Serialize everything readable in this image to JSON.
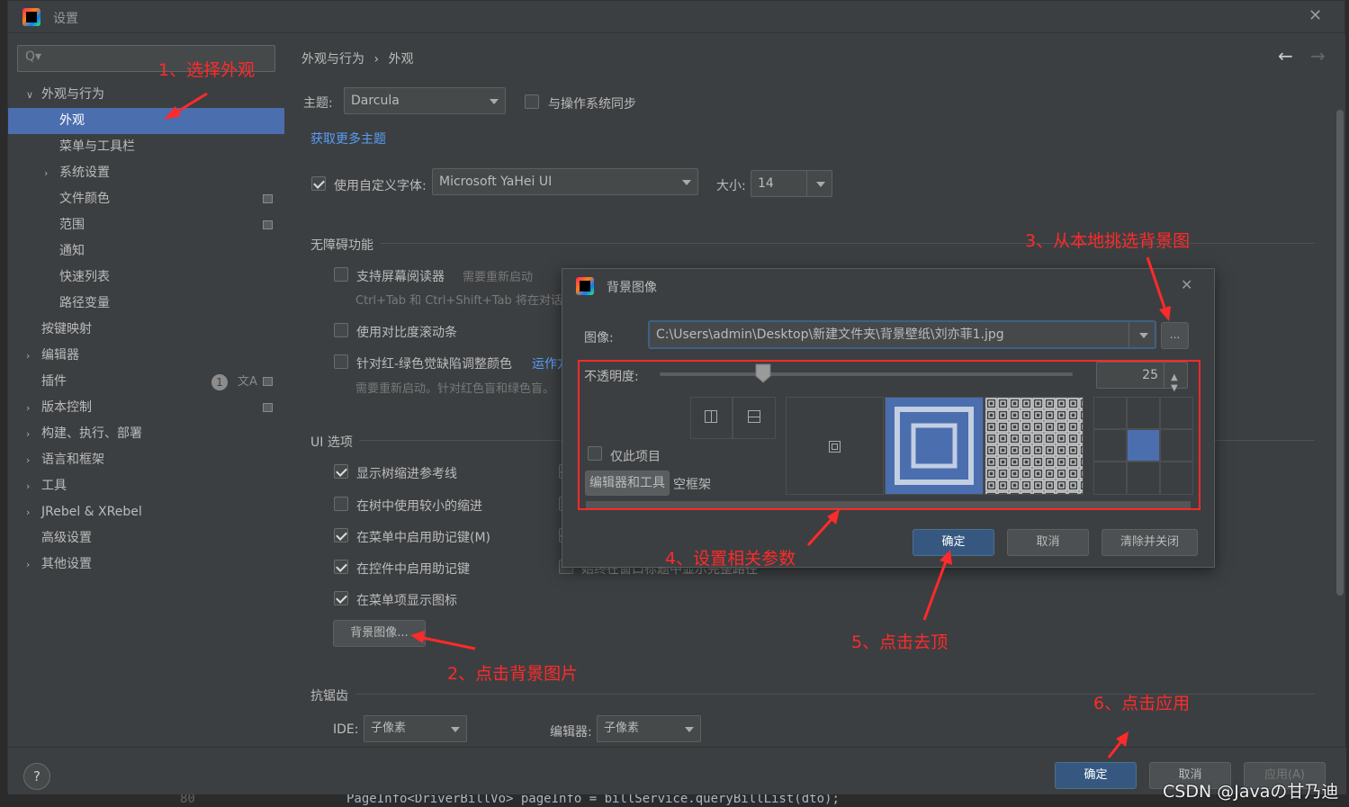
{
  "titlebar": {
    "title": "设置"
  },
  "search": {
    "placeholder": "Q▾"
  },
  "sidebar": {
    "items": [
      {
        "label": "外观与行为"
      },
      {
        "label": "外观"
      },
      {
        "label": "菜单与工具栏"
      },
      {
        "label": "系统设置"
      },
      {
        "label": "文件颜色"
      },
      {
        "label": "范围"
      },
      {
        "label": "通知"
      },
      {
        "label": "快速列表"
      },
      {
        "label": "路径变量"
      },
      {
        "label": "按键映射"
      },
      {
        "label": "编辑器"
      },
      {
        "label": "插件"
      },
      {
        "label": "版本控制"
      },
      {
        "label": "构建、执行、部署"
      },
      {
        "label": "语言和框架"
      },
      {
        "label": "工具"
      },
      {
        "label": "JRebel & XRebel"
      },
      {
        "label": "高级设置"
      },
      {
        "label": "其他设置"
      }
    ],
    "plugin_badge": "1"
  },
  "breadcrumb": {
    "parent": "外观与行为",
    "sep": "›",
    "current": "外观"
  },
  "theme": {
    "label": "主题:",
    "value": "Darcula",
    "sync_label": "与操作系统同步",
    "more_link": "获取更多主题"
  },
  "font": {
    "label": "使用自定义字体:",
    "value": "Microsoft YaHei UI",
    "size_label": "大小:",
    "size_value": "14"
  },
  "accessibility": {
    "title": "无障碍功能",
    "screen_reader": "支持屏幕阅读器",
    "restart_hint": "需要重新启动",
    "screen_reader_note": "Ctrl+Tab 和 Ctrl+Shift+Tab 将在对话",
    "contrast_scroll": "使用对比度滚动条",
    "color_blind": "针对红-绿色觉缺陷调整颜色",
    "color_blind_link": "运作方",
    "color_blind_note": "需要重新启动。针对红色盲和绿色盲。"
  },
  "ui_options": {
    "title": "UI 选项",
    "tree_indent": "显示树缩进参考线",
    "small_indent": "在树中使用较小的缩进",
    "menu_mnemonics": "在菜单中启用助记键(M)",
    "control_mnemonics": "在控件中启用助记键",
    "menu_icons": "在菜单项显示图标",
    "hidden_row": "始终在窗口标题中显示完整路径",
    "bg_button": "背景图像..."
  },
  "antialias": {
    "title": "抗锯齿",
    "ide_label": "IDE:",
    "ide_value": "子像素",
    "editor_label": "编辑器:",
    "editor_value": "子像素"
  },
  "dialog": {
    "title": "背景图像",
    "image_label": "图像:",
    "image_path": "C:\\Users\\admin\\Desktop\\新建文件夹\\背景壁纸\\刘亦菲1.jpg",
    "browse_label": "...",
    "opacity_label": "不透明度:",
    "opacity_value": "25",
    "opacity_fraction": 0.25,
    "this_project_label": "仅此项目",
    "target_button": "编辑器和工具",
    "target_empty": "空框架",
    "ok": "确定",
    "cancel": "取消",
    "clear_close": "清除并关闭"
  },
  "footer": {
    "help": "?",
    "ok": "确定",
    "cancel": "取消",
    "apply": "应用(A)"
  },
  "annotations": {
    "a1": "1、选择外观",
    "a2": "2、点击背景图片",
    "a3": "3、从本地挑选背景图",
    "a4": "4、设置相关参数",
    "a5": "5、点击去顶",
    "a6": "6、点击应用"
  },
  "code_line": {
    "line_no": "80",
    "text": "PageInfo<DriverBillVo> pageInfo = billService.queryBillList(dto);"
  },
  "watermark": "CSDN @Javaの甘乃迪",
  "colors": {
    "accent": "#4b6eaf",
    "default_button": "#365880",
    "annotation": "#ff2a2a",
    "link": "#589df6"
  }
}
